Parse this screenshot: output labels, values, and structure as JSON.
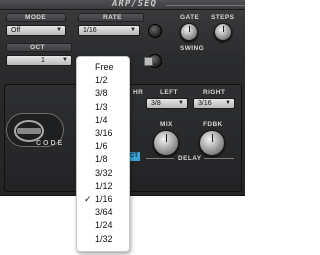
{
  "header": {
    "title": "ARP/SEQ"
  },
  "labels": {
    "mode": "MODE",
    "rate": "RATE",
    "oct": "OCT",
    "gate": "GATE",
    "steps": "STEPS",
    "swing": "SWING",
    "left": "LEFT",
    "right": "RIGHT",
    "mix": "MIX",
    "fdbk": "FDBK",
    "delay": "DELAY",
    "hr": "HR",
    "badge": "CT"
  },
  "mode_select": {
    "value": "Off"
  },
  "rate_select": {
    "value": "1/16"
  },
  "oct_select": {
    "value": "1"
  },
  "delay_left_select": {
    "value": "3/8"
  },
  "delay_right_select": {
    "value": "3/16"
  },
  "logo": {
    "text": "CODE"
  },
  "rate_menu": {
    "selected": "1/16",
    "check_glyph": "✓",
    "options": [
      "Free",
      "1/2",
      "3/8",
      "1/3",
      "1/4",
      "3/16",
      "1/6",
      "1/8",
      "3/32",
      "1/12",
      "1/16",
      "3/64",
      "1/24",
      "1/32"
    ]
  },
  "colors": {
    "accent": "#3ba3d7",
    "panel": "#2a2b2d"
  }
}
